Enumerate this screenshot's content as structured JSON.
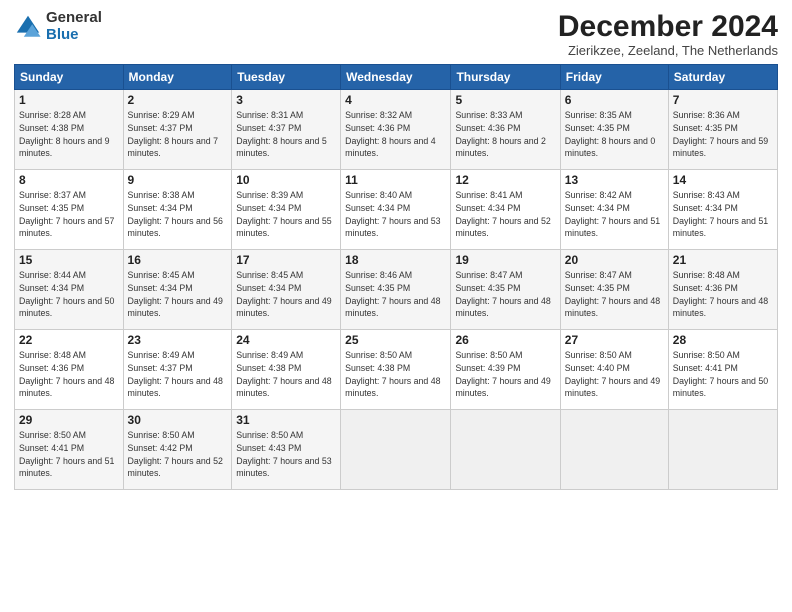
{
  "logo": {
    "general": "General",
    "blue": "Blue"
  },
  "title": "December 2024",
  "location": "Zierikzee, Zeeland, The Netherlands",
  "days_of_week": [
    "Sunday",
    "Monday",
    "Tuesday",
    "Wednesday",
    "Thursday",
    "Friday",
    "Saturday"
  ],
  "weeks": [
    [
      {
        "day": "1",
        "sunrise": "Sunrise: 8:28 AM",
        "sunset": "Sunset: 4:38 PM",
        "daylight": "Daylight: 8 hours and 9 minutes."
      },
      {
        "day": "2",
        "sunrise": "Sunrise: 8:29 AM",
        "sunset": "Sunset: 4:37 PM",
        "daylight": "Daylight: 8 hours and 7 minutes."
      },
      {
        "day": "3",
        "sunrise": "Sunrise: 8:31 AM",
        "sunset": "Sunset: 4:37 PM",
        "daylight": "Daylight: 8 hours and 5 minutes."
      },
      {
        "day": "4",
        "sunrise": "Sunrise: 8:32 AM",
        "sunset": "Sunset: 4:36 PM",
        "daylight": "Daylight: 8 hours and 4 minutes."
      },
      {
        "day": "5",
        "sunrise": "Sunrise: 8:33 AM",
        "sunset": "Sunset: 4:36 PM",
        "daylight": "Daylight: 8 hours and 2 minutes."
      },
      {
        "day": "6",
        "sunrise": "Sunrise: 8:35 AM",
        "sunset": "Sunset: 4:35 PM",
        "daylight": "Daylight: 8 hours and 0 minutes."
      },
      {
        "day": "7",
        "sunrise": "Sunrise: 8:36 AM",
        "sunset": "Sunset: 4:35 PM",
        "daylight": "Daylight: 7 hours and 59 minutes."
      }
    ],
    [
      {
        "day": "8",
        "sunrise": "Sunrise: 8:37 AM",
        "sunset": "Sunset: 4:35 PM",
        "daylight": "Daylight: 7 hours and 57 minutes."
      },
      {
        "day": "9",
        "sunrise": "Sunrise: 8:38 AM",
        "sunset": "Sunset: 4:34 PM",
        "daylight": "Daylight: 7 hours and 56 minutes."
      },
      {
        "day": "10",
        "sunrise": "Sunrise: 8:39 AM",
        "sunset": "Sunset: 4:34 PM",
        "daylight": "Daylight: 7 hours and 55 minutes."
      },
      {
        "day": "11",
        "sunrise": "Sunrise: 8:40 AM",
        "sunset": "Sunset: 4:34 PM",
        "daylight": "Daylight: 7 hours and 53 minutes."
      },
      {
        "day": "12",
        "sunrise": "Sunrise: 8:41 AM",
        "sunset": "Sunset: 4:34 PM",
        "daylight": "Daylight: 7 hours and 52 minutes."
      },
      {
        "day": "13",
        "sunrise": "Sunrise: 8:42 AM",
        "sunset": "Sunset: 4:34 PM",
        "daylight": "Daylight: 7 hours and 51 minutes."
      },
      {
        "day": "14",
        "sunrise": "Sunrise: 8:43 AM",
        "sunset": "Sunset: 4:34 PM",
        "daylight": "Daylight: 7 hours and 51 minutes."
      }
    ],
    [
      {
        "day": "15",
        "sunrise": "Sunrise: 8:44 AM",
        "sunset": "Sunset: 4:34 PM",
        "daylight": "Daylight: 7 hours and 50 minutes."
      },
      {
        "day": "16",
        "sunrise": "Sunrise: 8:45 AM",
        "sunset": "Sunset: 4:34 PM",
        "daylight": "Daylight: 7 hours and 49 minutes."
      },
      {
        "day": "17",
        "sunrise": "Sunrise: 8:45 AM",
        "sunset": "Sunset: 4:34 PM",
        "daylight": "Daylight: 7 hours and 49 minutes."
      },
      {
        "day": "18",
        "sunrise": "Sunrise: 8:46 AM",
        "sunset": "Sunset: 4:35 PM",
        "daylight": "Daylight: 7 hours and 48 minutes."
      },
      {
        "day": "19",
        "sunrise": "Sunrise: 8:47 AM",
        "sunset": "Sunset: 4:35 PM",
        "daylight": "Daylight: 7 hours and 48 minutes."
      },
      {
        "day": "20",
        "sunrise": "Sunrise: 8:47 AM",
        "sunset": "Sunset: 4:35 PM",
        "daylight": "Daylight: 7 hours and 48 minutes."
      },
      {
        "day": "21",
        "sunrise": "Sunrise: 8:48 AM",
        "sunset": "Sunset: 4:36 PM",
        "daylight": "Daylight: 7 hours and 48 minutes."
      }
    ],
    [
      {
        "day": "22",
        "sunrise": "Sunrise: 8:48 AM",
        "sunset": "Sunset: 4:36 PM",
        "daylight": "Daylight: 7 hours and 48 minutes."
      },
      {
        "day": "23",
        "sunrise": "Sunrise: 8:49 AM",
        "sunset": "Sunset: 4:37 PM",
        "daylight": "Daylight: 7 hours and 48 minutes."
      },
      {
        "day": "24",
        "sunrise": "Sunrise: 8:49 AM",
        "sunset": "Sunset: 4:38 PM",
        "daylight": "Daylight: 7 hours and 48 minutes."
      },
      {
        "day": "25",
        "sunrise": "Sunrise: 8:50 AM",
        "sunset": "Sunset: 4:38 PM",
        "daylight": "Daylight: 7 hours and 48 minutes."
      },
      {
        "day": "26",
        "sunrise": "Sunrise: 8:50 AM",
        "sunset": "Sunset: 4:39 PM",
        "daylight": "Daylight: 7 hours and 49 minutes."
      },
      {
        "day": "27",
        "sunrise": "Sunrise: 8:50 AM",
        "sunset": "Sunset: 4:40 PM",
        "daylight": "Daylight: 7 hours and 49 minutes."
      },
      {
        "day": "28",
        "sunrise": "Sunrise: 8:50 AM",
        "sunset": "Sunset: 4:41 PM",
        "daylight": "Daylight: 7 hours and 50 minutes."
      }
    ],
    [
      {
        "day": "29",
        "sunrise": "Sunrise: 8:50 AM",
        "sunset": "Sunset: 4:41 PM",
        "daylight": "Daylight: 7 hours and 51 minutes."
      },
      {
        "day": "30",
        "sunrise": "Sunrise: 8:50 AM",
        "sunset": "Sunset: 4:42 PM",
        "daylight": "Daylight: 7 hours and 52 minutes."
      },
      {
        "day": "31",
        "sunrise": "Sunrise: 8:50 AM",
        "sunset": "Sunset: 4:43 PM",
        "daylight": "Daylight: 7 hours and 53 minutes."
      },
      null,
      null,
      null,
      null
    ]
  ]
}
